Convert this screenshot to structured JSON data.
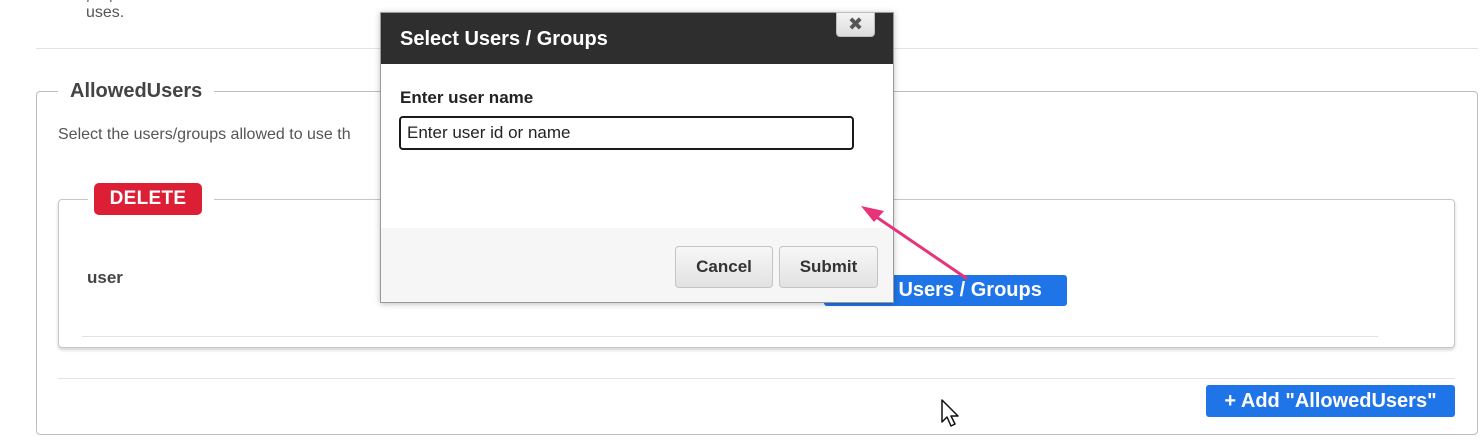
{
  "top_fragment": {
    "line1": "(…), …",
    "line2": "uses."
  },
  "allowed_users": {
    "legend": "AllowedUsers",
    "description": "Select the users/groups allowed to use th",
    "entry": {
      "delete_label": "DELETE",
      "user_label": "user",
      "select_button_label": "Select Users / Groups"
    },
    "add_button_label": "+ Add \"AllowedUsers\""
  },
  "modal": {
    "title": "Select Users / Groups",
    "close_glyph": "✖",
    "field_label": "Enter user name",
    "input_placeholder": "Enter user id or name",
    "cancel_label": "Cancel",
    "submit_label": "Submit"
  },
  "colors": {
    "primary_button": "#1f74e8",
    "delete_button": "#dc1f35",
    "modal_header": "#2e2e2e",
    "annotation_arrow": "#e6337a"
  },
  "icons": {
    "close": "close-icon",
    "cursor": "mouse-pointer-icon",
    "annotation": "arrow-annotation"
  }
}
